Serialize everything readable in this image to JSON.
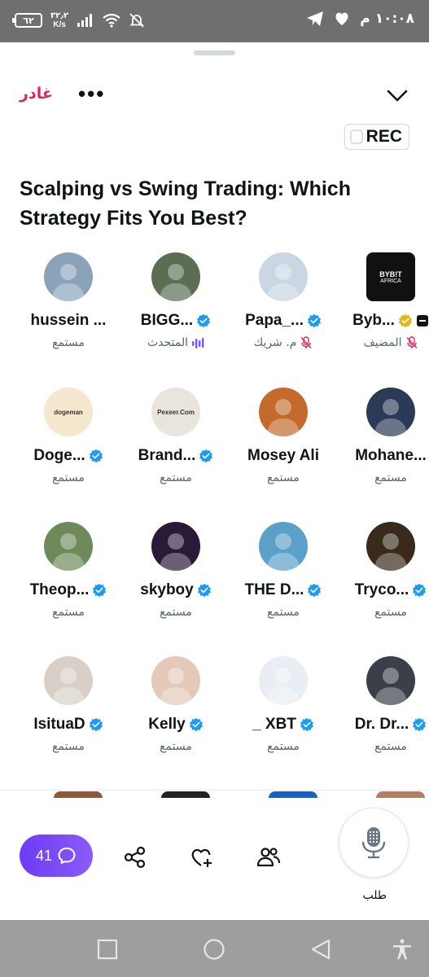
{
  "status_bar": {
    "battery": "٦٢",
    "net_speed_value": "٣٢٫٢",
    "net_speed_unit": "K/s",
    "time": "١٠:٠٨ م"
  },
  "header": {
    "leave_label": "غادر",
    "more_label": "•••",
    "rec_label": "REC"
  },
  "space": {
    "title": "Scalping vs Swing Trading: Which Strategy Fits You Best?"
  },
  "participants": [
    {
      "name": "hussein ...",
      "verified": false,
      "role": "مستمع",
      "role_icon": "none",
      "avatar_color": "#8aa3b8"
    },
    {
      "name": "BIGG...",
      "verified": true,
      "role": "المتحدث",
      "role_icon": "speaking-bars-icon",
      "avatar_color": "#5b6e52"
    },
    {
      "name": "Papa_...",
      "verified": true,
      "role": "م. شريك",
      "role_icon": "muted-mic-icon",
      "avatar_color": "#c9d6e3"
    },
    {
      "name": "Byb...",
      "verified": "gold",
      "role": "المضيف",
      "role_icon": "muted-mic-icon",
      "avatar_color": "#111111",
      "avatar_text_1": "BYB!T",
      "avatar_text_2": "AFRICA"
    },
    {
      "name": "Doge...",
      "verified": true,
      "role": "مستمع",
      "role_icon": "none",
      "avatar_color": "#f6e7cf",
      "avatar_text_1": "dogeman"
    },
    {
      "name": "Brand...",
      "verified": true,
      "role": "مستمع",
      "role_icon": "none",
      "avatar_color": "#e9e4dc",
      "avatar_text_1": "Pexeer.Com"
    },
    {
      "name": "Mosey Ali",
      "verified": false,
      "role": "مستمع",
      "role_icon": "none",
      "avatar_color": "#c46a2d"
    },
    {
      "name": "Mohane...",
      "verified": false,
      "role": "مستمع",
      "role_icon": "none",
      "avatar_color": "#2b3a55"
    },
    {
      "name": "Theop...",
      "verified": true,
      "role": "مستمع",
      "role_icon": "none",
      "avatar_color": "#6f8a5a"
    },
    {
      "name": "skyboy",
      "verified": true,
      "role": "مستمع",
      "role_icon": "none",
      "avatar_color": "#2a1a3a"
    },
    {
      "name": "THE D...",
      "verified": true,
      "role": "مستمع",
      "role_icon": "none",
      "avatar_color": "#5aa0c8"
    },
    {
      "name": "Tryco...",
      "verified": true,
      "role": "مستمع",
      "role_icon": "none",
      "avatar_color": "#3a2a1c"
    },
    {
      "name": "IsituaD",
      "verified": true,
      "role": "مستمع",
      "role_icon": "none",
      "avatar_color": "#d8d0c8"
    },
    {
      "name": "Kelly",
      "verified": true,
      "role": "مستمع",
      "role_icon": "none",
      "avatar_color": "#e4c9b8"
    },
    {
      "name": "_ XBT",
      "verified": true,
      "role": "مستمع",
      "role_icon": "none",
      "avatar_color": "#e8eef4"
    },
    {
      "name": "Dr. Dr...",
      "verified": true,
      "role": "مستمع",
      "role_icon": "none",
      "avatar_color": "#3b3f4a"
    }
  ],
  "controls": {
    "chat_count": "41",
    "mic_label": "طلب"
  },
  "colors": {
    "accent": "#1d9bf0",
    "leave": "#e0245e",
    "chat_gradient_start": "#6d3bf5",
    "speaking": "#7856ff",
    "muted": "#e0245e",
    "gold_badge": "#e2b719"
  }
}
